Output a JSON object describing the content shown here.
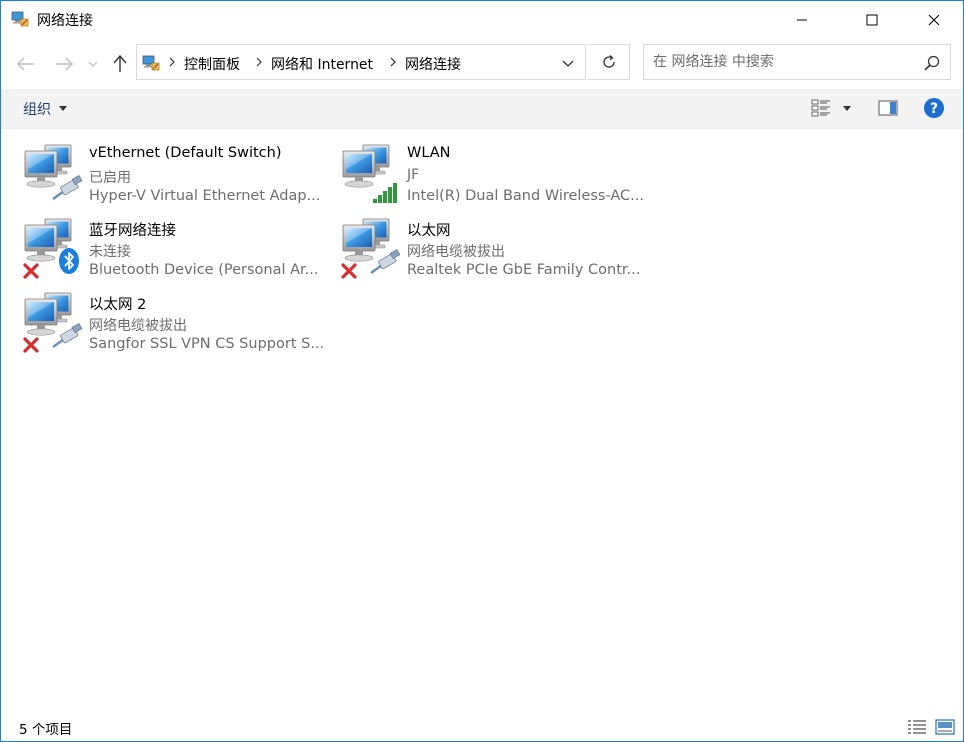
{
  "window": {
    "title": "网络连接"
  },
  "address": {
    "breadcrumbs": [
      "控制面板",
      "网络和 Internet",
      "网络连接"
    ]
  },
  "search": {
    "placeholder": "在 网络连接 中搜索",
    "value": ""
  },
  "toolbar": {
    "organize_label": "组织"
  },
  "connections": [
    {
      "name": "vEthernet (Default Switch)",
      "status": "已启用",
      "device": "Hyper-V Virtual Ethernet Adap...",
      "badge": "cable-icon"
    },
    {
      "name": "WLAN",
      "status": "JF",
      "device": "Intel(R) Dual Band Wireless-AC...",
      "badge": "signal-bars-icon"
    },
    {
      "name": "蓝牙网络连接",
      "status": "未连接",
      "device": "Bluetooth Device (Personal Ar...",
      "badge": "bluetooth-icon"
    },
    {
      "name": "以太网",
      "status": "网络电缆被拔出",
      "device": "Realtek PCIe GbE Family Contr...",
      "badge": "cable-icon"
    },
    {
      "name": "以太网 2",
      "status": "网络电缆被拔出",
      "device": "Sangfor SSL VPN CS Support S...",
      "badge": "cable-icon"
    }
  ],
  "statusbar": {
    "item_count": "5 个项目"
  },
  "colors": {
    "accent": "#1a7fd9",
    "help_blue": "#1b6fd1",
    "signal_green": "#2e9a3c",
    "error_red": "#d92b2b",
    "bluetooth_blue": "#1a7fe0"
  }
}
